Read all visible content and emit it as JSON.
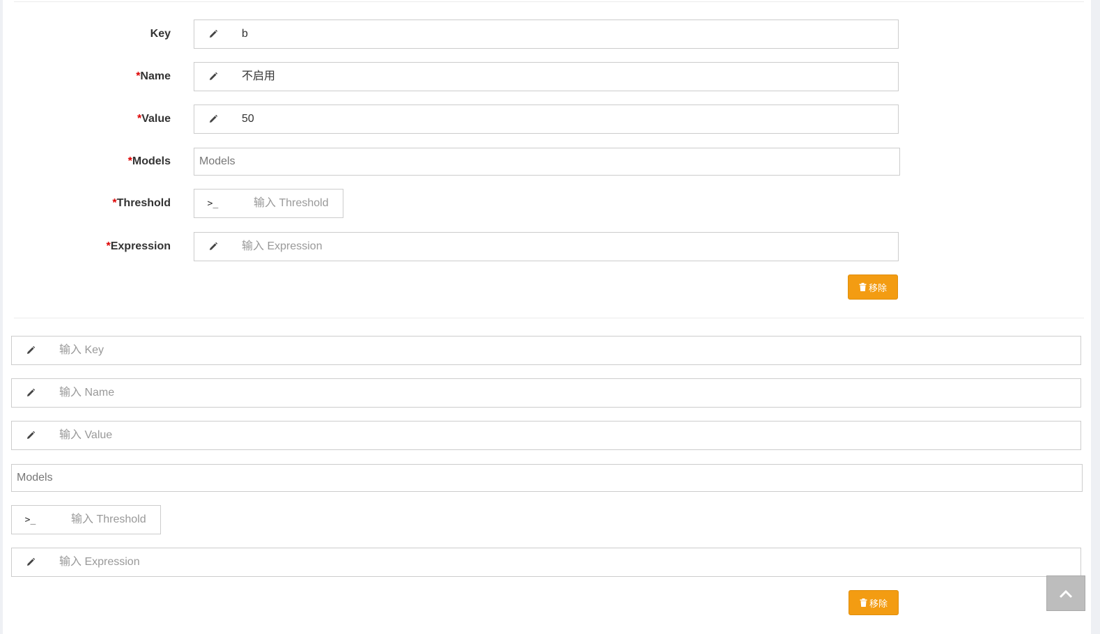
{
  "entry1": {
    "key": {
      "label": "Key",
      "required": "",
      "value": "b",
      "icon": "pencil-icon"
    },
    "name": {
      "label": "Name",
      "required": "*",
      "value": "不启用",
      "icon": "pencil-icon"
    },
    "value": {
      "label": "Value",
      "required": "*",
      "value": "50",
      "icon": "pencil-icon"
    },
    "models": {
      "label": "Models",
      "required": "*",
      "placeholder": "Models"
    },
    "threshold": {
      "label": "Threshold",
      "required": "*",
      "placeholder": "输入 Threshold",
      "addon": ">_",
      "icon": "terminal-icon"
    },
    "expression": {
      "label": "Expression",
      "required": "*",
      "placeholder": "输入 Expression",
      "icon": "pencil-icon"
    },
    "remove_label": "移除"
  },
  "entry2": {
    "key_placeholder": "输入 Key",
    "name_placeholder": "输入 Name",
    "value_placeholder": "输入 Value",
    "models_placeholder": "Models",
    "threshold_placeholder": "输入 Threshold",
    "threshold_addon": ">_",
    "expression_placeholder": "输入 Expression",
    "remove_label": "移除"
  },
  "colors": {
    "accent": "#f39c12",
    "required": "#dd0000",
    "border": "#cccccc"
  },
  "scroll_top_icon": "chevron-up-icon"
}
